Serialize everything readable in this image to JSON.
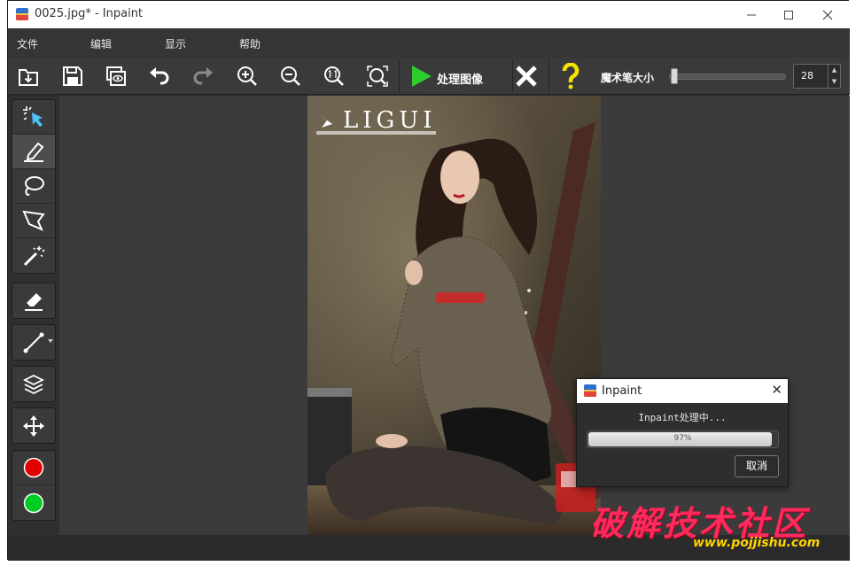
{
  "window": {
    "title": "0025.jpg* - Inpaint"
  },
  "menu": {
    "file": "文件",
    "edit": "编辑",
    "view": "显示",
    "help": "帮助"
  },
  "toolbar": {
    "process_label": "处理图像",
    "brush_size_label": "魔术笔大小",
    "brush_size_value": "28",
    "brush_size_fraction": 0.03
  },
  "image": {
    "brand": "LIGUI"
  },
  "left_tools": {
    "colors": [
      "#e00000",
      "#00cc22"
    ]
  },
  "dialog": {
    "title": "Inpaint",
    "message": "Inpaint处理中...",
    "progress_text": "97%",
    "progress_fraction": 0.97,
    "cancel_label": "取消"
  },
  "watermark": {
    "text": "破解技术社区",
    "url": "www.pojjishu.com"
  },
  "colors": {
    "accent_green": "#2ecc2e",
    "help_yellow": "#f5e400"
  }
}
